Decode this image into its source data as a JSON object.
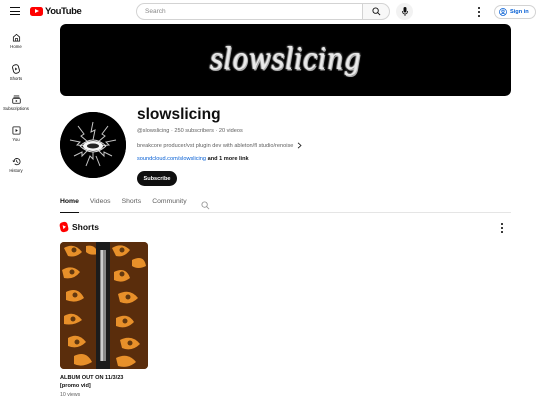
{
  "header": {
    "logo_text": "YouTube",
    "search_placeholder": "Search",
    "signin_label": "Sign in"
  },
  "sidebar": {
    "items": [
      {
        "label": "Home",
        "icon": "home-icon"
      },
      {
        "label": "Shorts",
        "icon": "shorts-icon"
      },
      {
        "label": "Subscriptions",
        "icon": "subscriptions-icon"
      },
      {
        "label": "You",
        "icon": "you-icon"
      },
      {
        "label": "History",
        "icon": "history-icon"
      }
    ]
  },
  "banner": {
    "text": "slowslicing"
  },
  "channel": {
    "name": "slowslicing",
    "meta": "@slowslicing · 250 subscribers · 20 videos",
    "description": "breakcore producer/vst plugin dev with ableton/fl studio/renoise",
    "link_url": "soundcloud.com/slowslicing",
    "link_more": "and 1 more link",
    "subscribe_label": "Subscribe"
  },
  "tabs": [
    "Home",
    "Videos",
    "Shorts",
    "Community"
  ],
  "active_tab": "Home",
  "shorts": {
    "section_title": "Shorts",
    "items": [
      {
        "title": "ALBUM OUT ON 11/3/23\n[promo vid]",
        "views": "10 views"
      }
    ]
  },
  "colors": {
    "brand_red": "#ff0000",
    "link_blue": "#065fd4",
    "text_primary": "#0f0f0f",
    "text_secondary": "#606060"
  }
}
